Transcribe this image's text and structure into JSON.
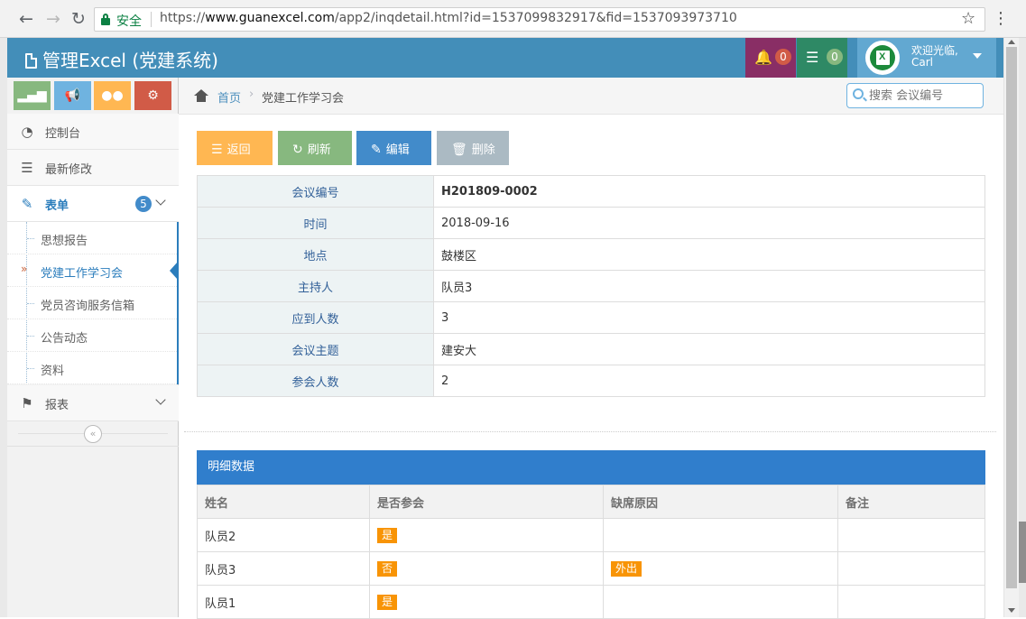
{
  "browser": {
    "secure_label": "安全",
    "url_prefix": "https://",
    "url_host": "www.guanexcel.com",
    "url_path": "/app2/inqdetail.html?id=1537099832917&fid=1537093973710"
  },
  "header": {
    "title": "管理Excel (党建系统)",
    "notifications_count": "0",
    "tasks_count": "0",
    "welcome": "欢迎光临,",
    "user_name": "Carl"
  },
  "sidebar": {
    "items": [
      {
        "label": "控制台",
        "icon": "dashboard-icon"
      },
      {
        "label": "最新修改",
        "icon": "list-icon"
      },
      {
        "label": "表单",
        "icon": "edit-icon",
        "badge": "5"
      },
      {
        "label": "报表",
        "icon": "tag-icon"
      }
    ],
    "submenu": [
      "思想报告",
      "党建工作学习会",
      "党员咨询服务信箱",
      "公告动态",
      "资料"
    ]
  },
  "breadcrumb": {
    "home": "首页",
    "current": "党建工作学习会"
  },
  "search": {
    "placeholder": "搜索 会议编号"
  },
  "toolbar": {
    "back": "返回",
    "refresh": "刷新",
    "edit": "编辑",
    "delete": "删除"
  },
  "detail": [
    {
      "key": "会议编号",
      "value": "H201809-0002",
      "bold": true
    },
    {
      "key": "时间",
      "value": "2018-09-16"
    },
    {
      "key": "地点",
      "value": "鼓楼区"
    },
    {
      "key": "主持人",
      "value": "队员3"
    },
    {
      "key": "应到人数",
      "value": "3"
    },
    {
      "key": "会议主题",
      "value": "建安大"
    },
    {
      "key": "参会人数",
      "value": "2"
    }
  ],
  "list": {
    "title": "明细数据",
    "columns": [
      "姓名",
      "是否参会",
      "缺席原因",
      "备注"
    ],
    "rows": [
      {
        "name": "队员2",
        "attend": "是",
        "reason": "",
        "note": ""
      },
      {
        "name": "队员3",
        "attend": "否",
        "reason": "外出",
        "note": ""
      },
      {
        "name": "队员1",
        "attend": "是",
        "reason": "",
        "note": ""
      }
    ]
  },
  "colors": {
    "header": "#438eb9",
    "accent": "#307ecc",
    "tag": "#f89406"
  }
}
